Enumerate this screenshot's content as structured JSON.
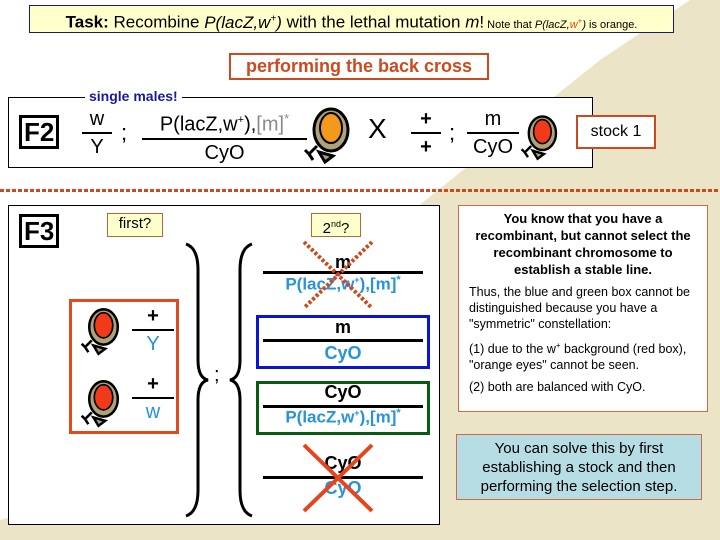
{
  "colors": {
    "background_band": "#ebe4c6",
    "accent_orange": "#cc4a1f",
    "genotype_blue": "#2893d8",
    "blue_box": "#0a14d6",
    "green_box": "#0b5a12",
    "task_bg": "#ffffcc",
    "solve_bg": "#b6dde3",
    "eye_orange": "#f39a1a",
    "eye_red": "#f03a1a"
  },
  "header": {
    "task_prefix": "Task:",
    "task_text1": " Recombine ",
    "task_construct": "P(lacZ,w",
    "task_sup": "+",
    "task_close": ")",
    "task_text2": " with the lethal mutation ",
    "task_m": "m",
    "task_excl": "!",
    "note_prefix": " Note that ",
    "note_construct": "P(lacZ,",
    "note_w": "w",
    "note_sup": "+",
    "note_close": ")",
    "note_suffix": " is orange."
  },
  "subtitle": "performing the back cross",
  "f2": {
    "generation_label": "F2",
    "legend": "single males!",
    "male": {
      "x_top": "w",
      "x_bottom": "Y",
      "separator": ";",
      "chr2_top_text": "P(lacZ,w",
      "chr2_top_sup": "+",
      "chr2_top_close": "),",
      "chr2_top_m": "[m]",
      "chr2_top_star": "*",
      "chr2_bottom": "CyO",
      "eye_color": "orange"
    },
    "cross_symbol": "X",
    "female": {
      "x_top": "+",
      "x_bottom": "+",
      "separator": ";",
      "chr2_top": "m",
      "chr2_bottom": "CyO",
      "eye_color": "red"
    },
    "stock_label": "stock 1"
  },
  "f3": {
    "generation_label": "F3",
    "first_label": "first?",
    "second_label_base": "2",
    "second_label_sup": "nd",
    "second_label_q": "?",
    "x_genotypes": [
      {
        "top": "+",
        "bottom": "Y",
        "eye_color": "red"
      },
      {
        "top": "+",
        "bottom": "w",
        "eye_color": "red"
      }
    ],
    "separator": ";",
    "chr2_genotypes": [
      {
        "top": "m",
        "bottom": "P(lacZ,w+),[m]*",
        "bottom_text": "P(lacZ,w",
        "bottom_sup": "+",
        "bottom_close": "),[m]",
        "bottom_star": "*",
        "crossed": "dotted",
        "box": "none"
      },
      {
        "top": "m",
        "bottom": "CyO",
        "crossed": "none",
        "box": "blue"
      },
      {
        "top": "CyO",
        "bottom": "P(lacZ,w+),[m]*",
        "bottom_text": "P(lacZ,w",
        "bottom_sup": "+",
        "bottom_close": "),[m]",
        "bottom_star": "*",
        "crossed": "none",
        "box": "green"
      },
      {
        "top": "CyO",
        "bottom": "CyO",
        "crossed": "solid",
        "box": "none"
      }
    ]
  },
  "info": {
    "heading": "You know that you have a recombinant, but cannot select the recombinant chromosome to establish a stable line.",
    "para1": "Thus, the blue and green box cannot be distinguished because you have a \"symmetric\" constellation:",
    "para2_pre": "(1) due to the w",
    "para2_sup": "+",
    "para2_post": " background (red box), \"orange eyes\" cannot be seen.",
    "para3": "(2) both are balanced with CyO."
  },
  "solution": "You can solve this by first establishing a stock and then performing the selection step."
}
